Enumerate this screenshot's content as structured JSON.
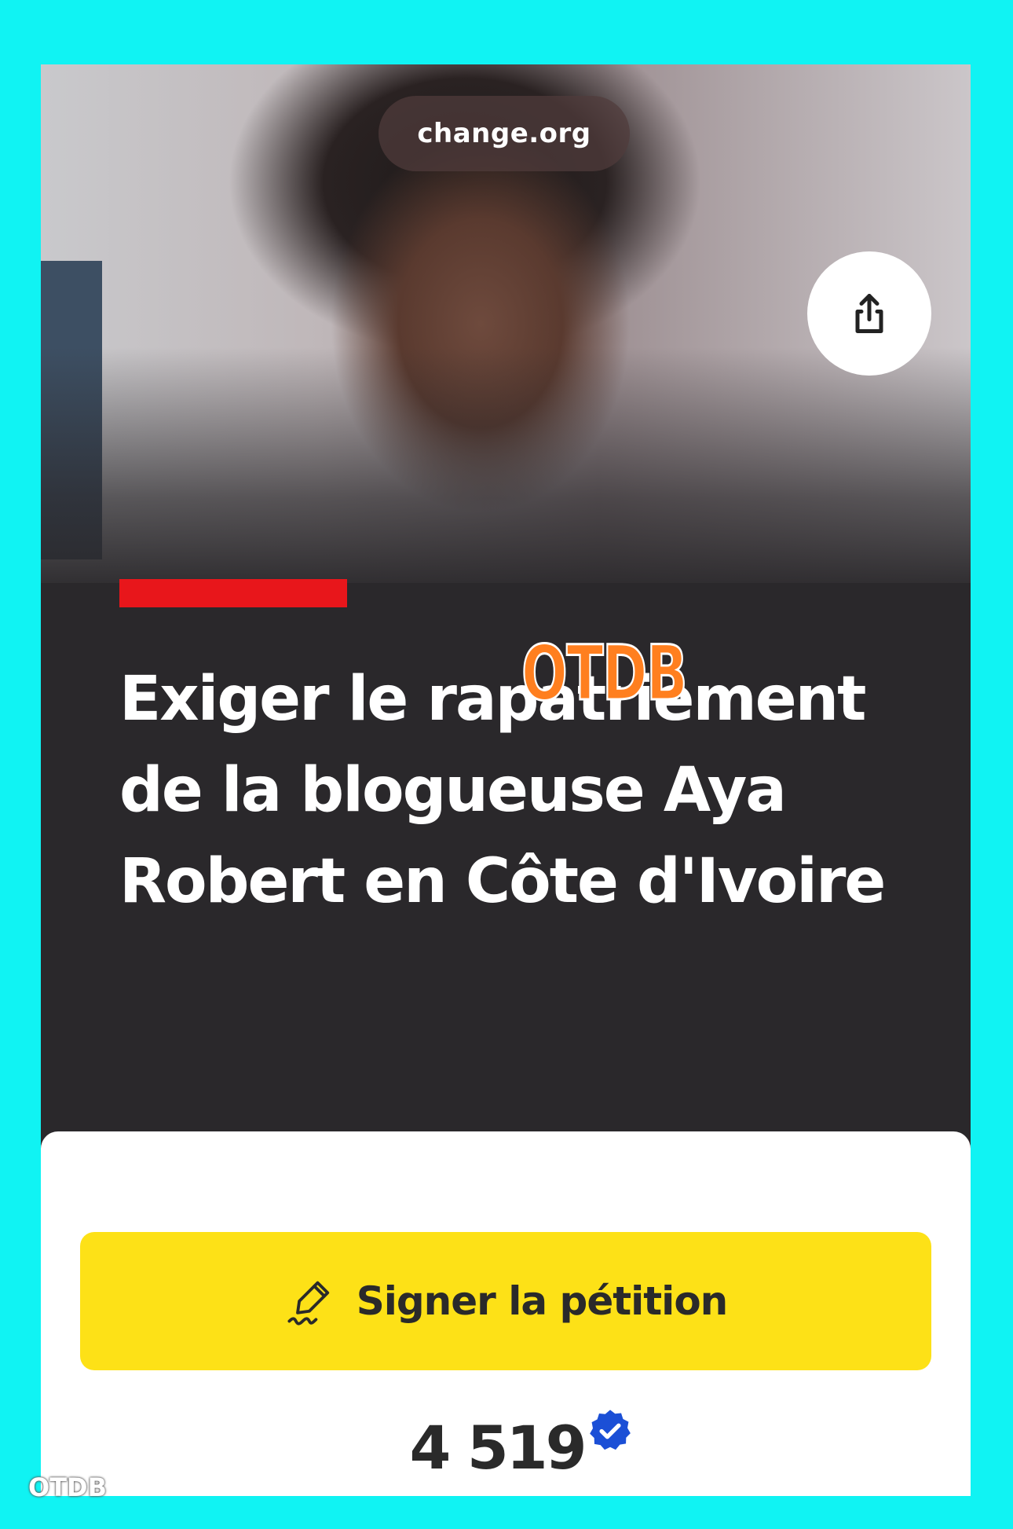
{
  "header": {
    "site_label": "change.org",
    "share_icon": "share-icon"
  },
  "petition": {
    "title": "Exiger le rapatriement de la blogueuse Aya Robert en Côte d'Ivoire",
    "accent_color": "#e8161b",
    "sign_button_label": "Signer la pétition",
    "sign_icon": "signature-pen-icon",
    "button_color": "#fde117",
    "signature_count": "4 519",
    "verified_icon": "verified-badge-icon"
  },
  "overlay": {
    "watermark_center": "OTDB",
    "watermark_corner": "OTDB",
    "watermark_color": "#ff7f1f"
  },
  "colors": {
    "frame": "#10f3f3",
    "dark_panel": "#2a282b"
  }
}
